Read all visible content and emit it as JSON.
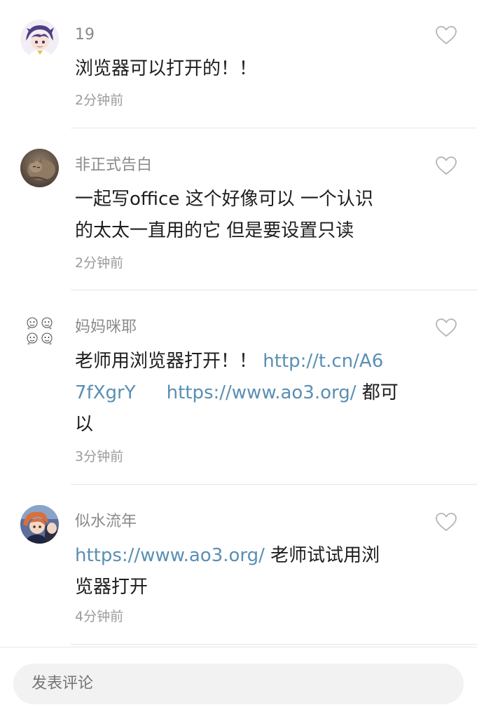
{
  "comments": [
    {
      "username": "19",
      "lines": [
        [
          {
            "text": "浏览器可以打开的！！"
          }
        ]
      ],
      "time": "2分钟前",
      "avatar_icon": "anime-character-purple-hair-avatar"
    },
    {
      "username": "非正式告白",
      "lines": [
        [
          {
            "text": "一起写office 这个好像可以 一个认识"
          }
        ],
        [
          {
            "text": "的太太一直用的它 但是要设置只读"
          }
        ]
      ],
      "time": "2分钟前",
      "avatar_icon": "cat-photo-avatar"
    },
    {
      "username": "妈妈咪耶",
      "lines": [
        [
          {
            "text": "老师用浏览器打开！！ "
          },
          {
            "text": "http://t.cn/A6",
            "link": true
          }
        ],
        [
          {
            "text": "7fXgrY",
            "link": true
          },
          {
            "gap": true
          },
          {
            "text": "https://www.ao3.org/",
            "link": true
          },
          {
            "text": "  都可"
          }
        ],
        [
          {
            "text": "以"
          }
        ]
      ],
      "time": "3分钟前",
      "avatar_icon": "cartoon-faces-grid-avatar"
    },
    {
      "username": "似水流年",
      "lines": [
        [
          {
            "text": "https://www.ao3.org/",
            "link": true
          },
          {
            "text": " 老师试试用浏"
          }
        ],
        [
          {
            "text": "览器打开"
          }
        ]
      ],
      "time": "4分钟前",
      "avatar_icon": "anime-character-orange-hair-avatar"
    }
  ],
  "comment_input": {
    "placeholder": "发表评论"
  },
  "colors": {
    "link": "#5a8fb3",
    "username": "#8a8a8a",
    "body_text": "#1e1e1e",
    "timestamp": "#9b9b9b",
    "like_icon_stroke": "#b5b5b5",
    "input_bg": "#f2f2f2"
  },
  "icons": {
    "like": "heart-outline-icon"
  }
}
